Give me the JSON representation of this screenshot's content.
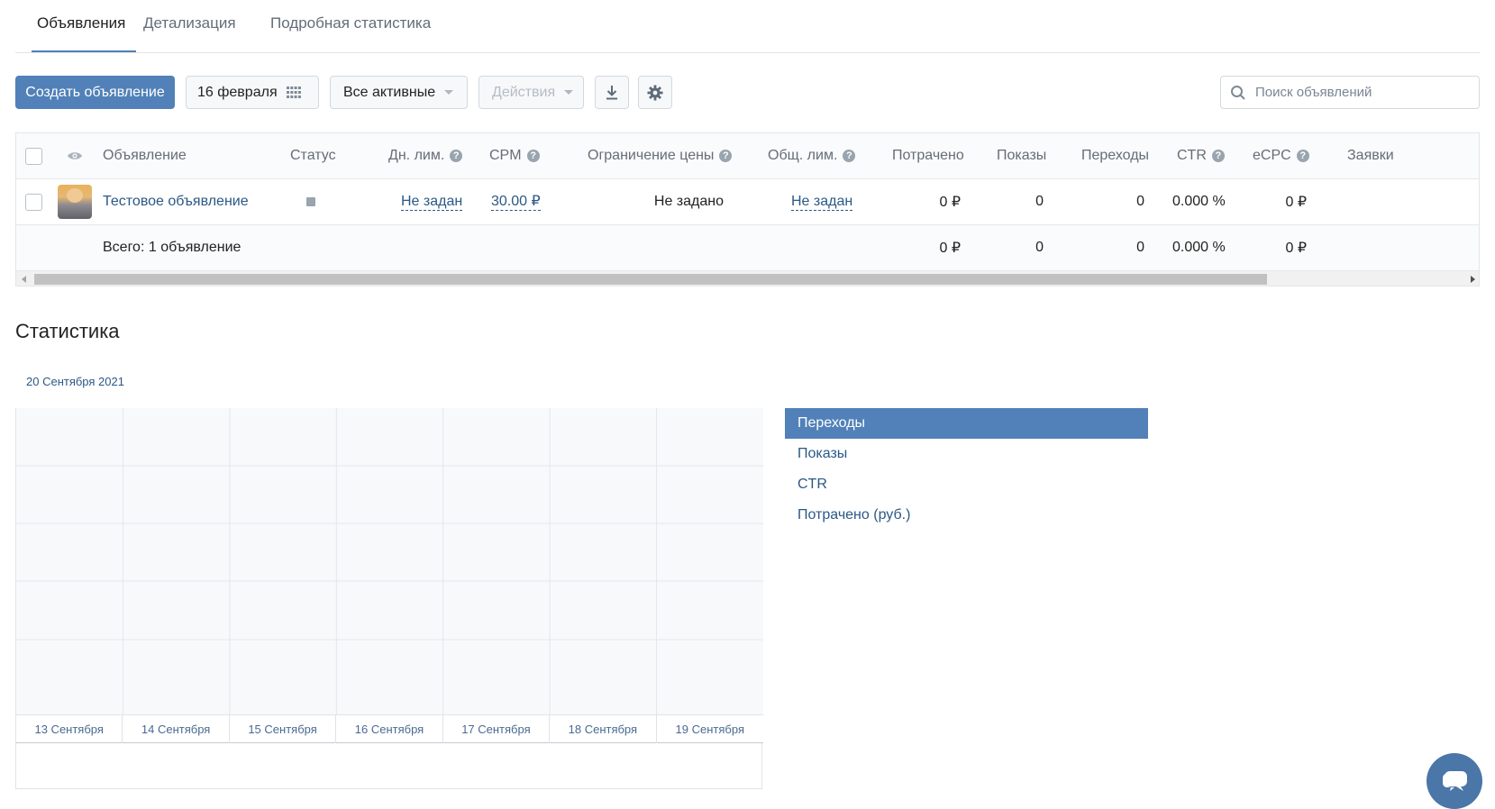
{
  "tabs": [
    {
      "label": "Объявления",
      "active": true
    },
    {
      "label": "Детализация"
    },
    {
      "label": "Подробная статистика"
    }
  ],
  "toolbar": {
    "create_label": "Создать объявление",
    "date_label": "16 февраля",
    "filter_label": "Все активные",
    "actions_label": "Действия",
    "download_icon": "download-icon",
    "settings_icon": "gear-icon",
    "search_placeholder": "Поиск объявлений"
  },
  "table": {
    "headers": {
      "ad": "Объявление",
      "status": "Статус",
      "daily_limit": "Дн. лим.",
      "cpm": "CPM",
      "price_limit": "Ограничение цены",
      "total_limit": "Общ. лим.",
      "spent": "Потрачено",
      "impressions": "Показы",
      "clicks": "Переходы",
      "ctr": "CTR",
      "ecpc": "eCPC",
      "leads": "Заявки"
    },
    "row": {
      "ad_name": "Тестовое объявление",
      "daily_limit": "Не задан",
      "cpm": "30.00 ₽",
      "price_limit": "Не задано",
      "total_limit": "Не задан",
      "spent": "0 ₽",
      "impressions": "0",
      "clicks": "0",
      "ctr": "0.000 %",
      "ecpc": "0 ₽"
    },
    "total": {
      "label": "Всего: 1 объявление",
      "spent": "0 ₽",
      "impressions": "0",
      "clicks": "0",
      "ctr": "0.000 %",
      "ecpc": "0 ₽"
    }
  },
  "stats": {
    "title": "Статистика",
    "date": "20 Сентября 2021",
    "metrics": [
      "Переходы",
      "Показы",
      "CTR",
      "Потрачено (руб.)"
    ],
    "active_metric": "Переходы"
  },
  "chart_data": {
    "type": "line",
    "categories": [
      "13 Сентября",
      "14 Сентября",
      "15 Сентября",
      "16 Сентября",
      "17 Сентября",
      "18 Сентября",
      "19 Сентября"
    ],
    "series": [],
    "grid": true
  },
  "colors": {
    "accent": "#5181b8",
    "link": "#2a5885"
  }
}
